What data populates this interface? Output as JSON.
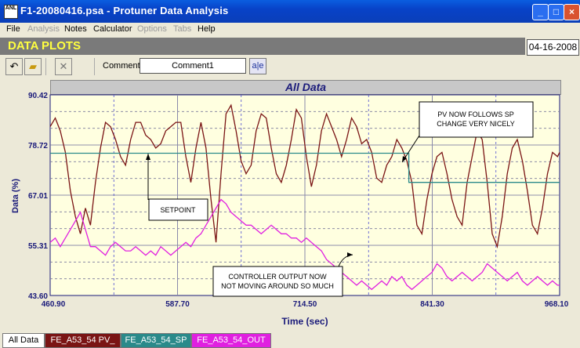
{
  "window": {
    "title": "F1-20080416.psa - Protuner Data  Analysis",
    "icon_text": "ANL"
  },
  "menu": [
    {
      "label": "File",
      "enabled": true
    },
    {
      "label": "Analysis",
      "enabled": false
    },
    {
      "label": "Notes",
      "enabled": true
    },
    {
      "label": "Calculator",
      "enabled": true
    },
    {
      "label": "Options",
      "enabled": false
    },
    {
      "label": "Tabs",
      "enabled": false
    },
    {
      "label": "Help",
      "enabled": true
    }
  ],
  "header": {
    "title": "DATA PLOTS",
    "date": "04-16-2008"
  },
  "toolbar": {
    "comment_label": "Comment",
    "comment_value": "Comment1",
    "ae_label": "a|e"
  },
  "chart_data": {
    "type": "line",
    "title": "All Data",
    "xlabel": "Time (sec)",
    "ylabel": "Data (%)",
    "x_ticks": [
      "460.90",
      "587.70",
      "714.50",
      "841.30",
      "968.10"
    ],
    "y_ticks": [
      "90.42",
      "78.72",
      "67.01",
      "55.31",
      "43.60"
    ],
    "xlim": [
      460.9,
      968.1
    ],
    "ylim": [
      43.6,
      90.42
    ],
    "grid": true,
    "series": [
      {
        "name": "FE_A53_54 PV_",
        "color": "#7a1414",
        "x": [
          460.9,
          466,
          471,
          476,
          481,
          486,
          491,
          496,
          501,
          506,
          511,
          516,
          521,
          526,
          531,
          536,
          541,
          546,
          551,
          556,
          561,
          566,
          571,
          576,
          581,
          586,
          591,
          596,
          601,
          606,
          611,
          616,
          621,
          626,
          631,
          636,
          641,
          646,
          651,
          656,
          661,
          666,
          671,
          676,
          681,
          686,
          691,
          696,
          701,
          706,
          711,
          716,
          721,
          726,
          731,
          736,
          741,
          746,
          751,
          756,
          761,
          766,
          771,
          776,
          781,
          786,
          791,
          796,
          801,
          806,
          811,
          816,
          821,
          826,
          831,
          836,
          841,
          846,
          851,
          856,
          861,
          866,
          871,
          876,
          881,
          886,
          891,
          896,
          901,
          906,
          911,
          916,
          921,
          926,
          931,
          936,
          941,
          946,
          951,
          956,
          961,
          966,
          968.1
        ],
        "y": [
          83,
          85,
          82,
          77,
          68,
          62,
          58,
          64,
          60,
          70,
          78,
          84,
          83,
          80,
          76,
          74,
          80,
          84,
          84,
          81,
          80,
          78,
          79,
          82,
          83,
          84,
          84,
          76,
          70,
          78,
          84,
          78,
          66,
          56,
          72,
          86,
          88,
          82,
          75,
          72,
          74,
          82,
          86,
          85,
          78,
          72,
          70,
          74,
          80,
          87,
          85,
          76,
          69,
          74,
          82,
          86,
          83,
          80,
          76,
          80,
          85,
          83,
          79,
          80,
          77,
          71,
          70,
          74,
          76,
          80,
          78,
          75,
          70,
          60,
          58,
          66,
          72,
          76,
          77,
          72,
          66,
          62,
          60,
          70,
          76,
          82,
          80,
          70,
          58,
          55,
          62,
          72,
          78,
          80,
          75,
          68,
          60,
          58,
          64,
          72,
          77,
          76,
          77
        ]
      },
      {
        "name": "FE_A53_54_SP",
        "color": "#2a8a8a",
        "x": [
          460.9,
          818,
          818,
          968.1
        ],
        "y": [
          76.8,
          76.8,
          70.0,
          70.0
        ]
      },
      {
        "name": "FE_A53_54_OUT",
        "color": "#e020e0",
        "x": [
          460.9,
          466,
          471,
          476,
          481,
          486,
          491,
          496,
          501,
          506,
          511,
          516,
          521,
          526,
          531,
          536,
          541,
          546,
          551,
          556,
          561,
          566,
          571,
          576,
          581,
          586,
          591,
          596,
          601,
          606,
          611,
          616,
          621,
          626,
          631,
          636,
          641,
          646,
          651,
          656,
          661,
          666,
          671,
          676,
          681,
          686,
          691,
          696,
          701,
          706,
          711,
          716,
          721,
          726,
          731,
          736,
          741,
          746,
          751,
          756,
          761,
          766,
          771,
          776,
          781,
          786,
          791,
          796,
          801,
          806,
          811,
          816,
          821,
          826,
          831,
          836,
          841,
          846,
          851,
          856,
          861,
          866,
          871,
          876,
          881,
          886,
          891,
          896,
          901,
          906,
          911,
          916,
          921,
          926,
          931,
          936,
          941,
          946,
          951,
          956,
          961,
          966,
          968.1
        ],
        "y": [
          56,
          57,
          55,
          57,
          59,
          61,
          63,
          59,
          55,
          55,
          54,
          53,
          55,
          56,
          55,
          54,
          54,
          55,
          54,
          53,
          54,
          53,
          55,
          54,
          53,
          54,
          55,
          56,
          55,
          57,
          58,
          60,
          62,
          64,
          66,
          65,
          63,
          62,
          61,
          60,
          60,
          59,
          58,
          59,
          60,
          59,
          58,
          58,
          57,
          57,
          56,
          57,
          56,
          55,
          54,
          52,
          51,
          50,
          49,
          48,
          47,
          46,
          47,
          46,
          45,
          46,
          47,
          46,
          48,
          47,
          48,
          46,
          45,
          46,
          47,
          48,
          49,
          51,
          50,
          48,
          47,
          48,
          49,
          48,
          47,
          48,
          49,
          51,
          50,
          49,
          48,
          47,
          48,
          49,
          47,
          46,
          47,
          48,
          47,
          46,
          47,
          46,
          46
        ]
      }
    ],
    "annotations": [
      {
        "text": "PV NOW FOLLOWS SP\nCHANGE VERY NICELY"
      },
      {
        "text": "SETPOINT"
      },
      {
        "text": "CONTROLLER OUTPUT NOW\nNOT MOVING AROUND SO MUCH"
      }
    ]
  },
  "tabs": [
    {
      "label": "All Data",
      "bg": "#ffffff",
      "fg": "#000000",
      "active": true
    },
    {
      "label": "FE_A53_54 PV_",
      "bg": "#7a1414",
      "fg": "#ffffff",
      "active": false
    },
    {
      "label": "FE_A53_54_SP",
      "bg": "#2a8a8a",
      "fg": "#ffffff",
      "active": false
    },
    {
      "label": "FE_A53_54_OUT",
      "bg": "#e020e0",
      "fg": "#ffffff",
      "active": false
    }
  ]
}
